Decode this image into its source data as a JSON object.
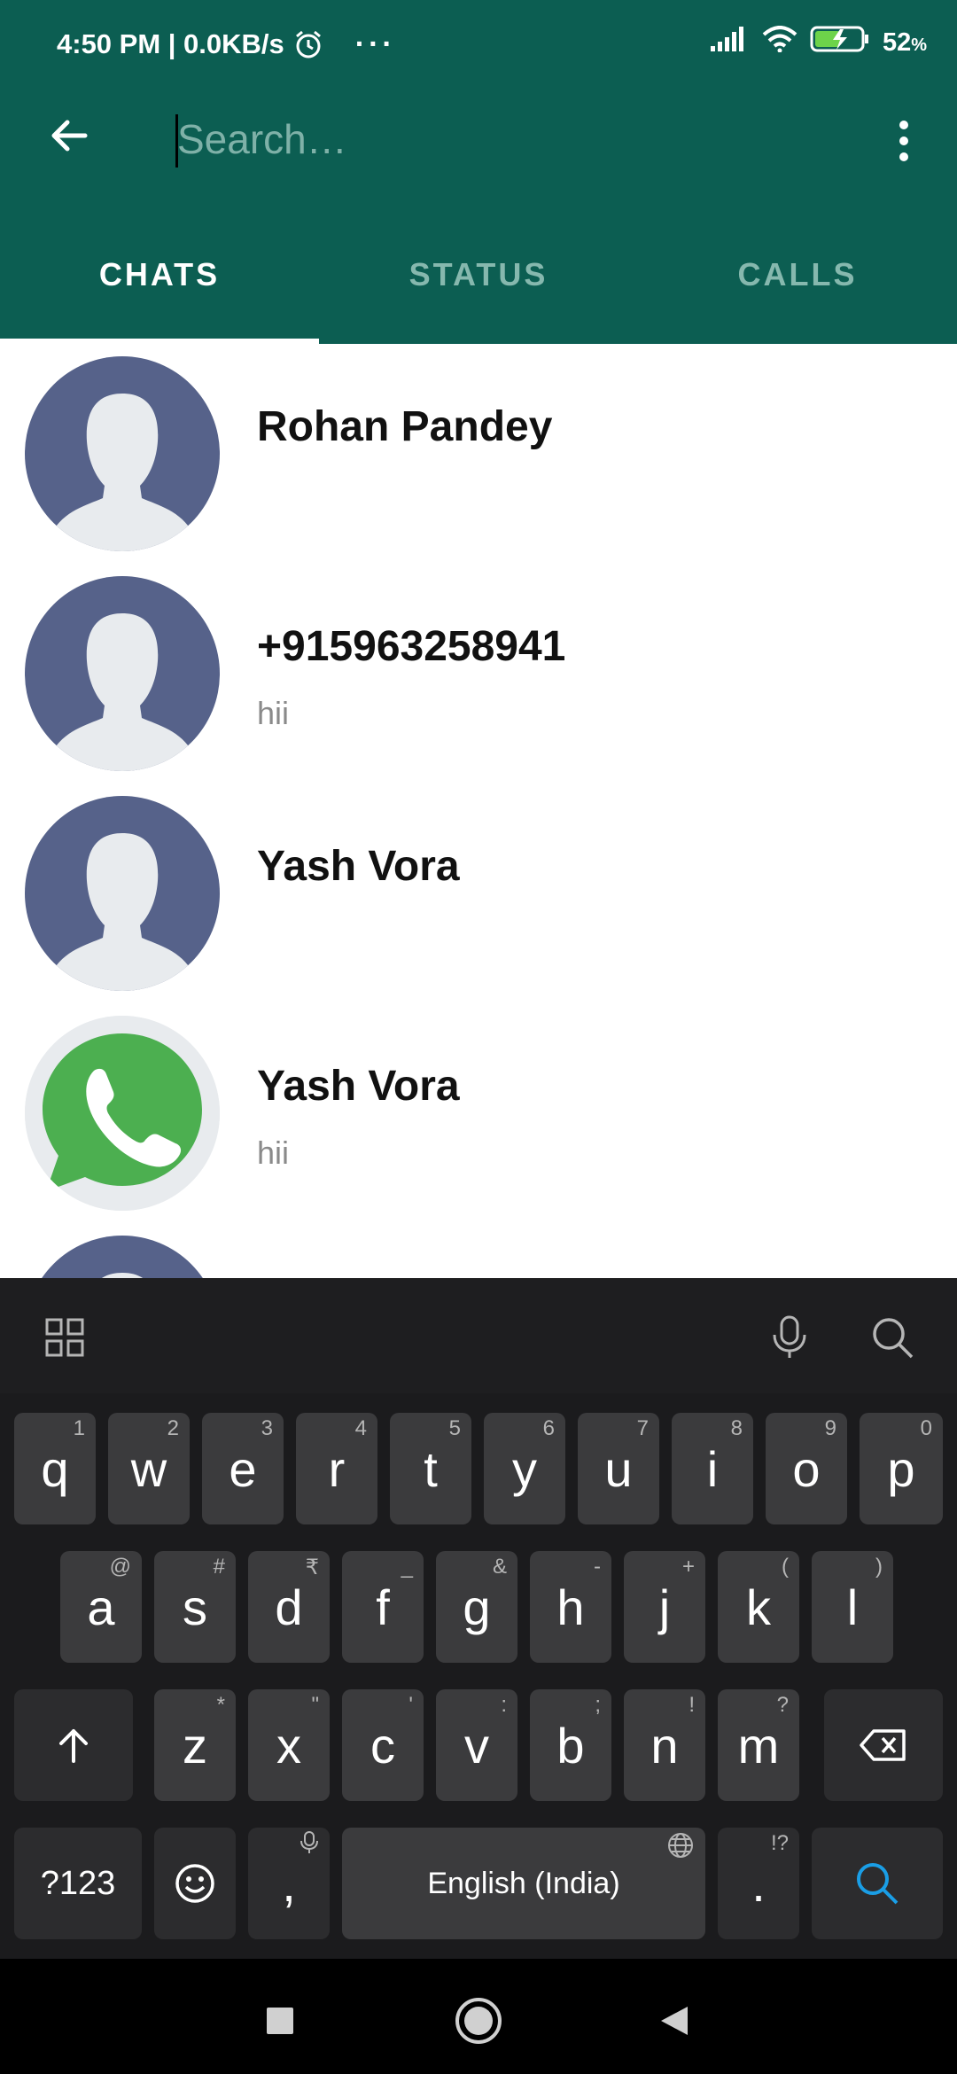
{
  "status_bar": {
    "time": "4:50 PM | 0.0KB/s",
    "more": "···",
    "battery_percent": "52",
    "battery_unit": "%",
    "icons": [
      "alarm-icon",
      "signal-icon",
      "wifi-icon",
      "battery-charging-icon"
    ]
  },
  "toolbar": {
    "search_placeholder": "Search…",
    "search_value": "",
    "back_icon": "arrow-left-icon",
    "menu_icon": "more-vert-icon"
  },
  "tabs": [
    {
      "label": "CHATS",
      "active": true
    },
    {
      "label": "STATUS",
      "active": false
    },
    {
      "label": "CALLS",
      "active": false
    }
  ],
  "chats": [
    {
      "name": "Rohan Pandey",
      "message": "",
      "avatar": "default-avatar"
    },
    {
      "name": "+915963258941",
      "message": "hii",
      "avatar": "default-avatar"
    },
    {
      "name": "Yash Vora",
      "message": "",
      "avatar": "default-avatar"
    },
    {
      "name": "Yash Vora",
      "message": "hii",
      "avatar": "whatsapp-avatar"
    }
  ],
  "keyboard": {
    "row1": [
      {
        "k": "q",
        "h": "1"
      },
      {
        "k": "w",
        "h": "2"
      },
      {
        "k": "e",
        "h": "3"
      },
      {
        "k": "r",
        "h": "4"
      },
      {
        "k": "t",
        "h": "5"
      },
      {
        "k": "y",
        "h": "6"
      },
      {
        "k": "u",
        "h": "7"
      },
      {
        "k": "i",
        "h": "8"
      },
      {
        "k": "o",
        "h": "9"
      },
      {
        "k": "p",
        "h": "0"
      }
    ],
    "row2": [
      {
        "k": "a",
        "h": "@"
      },
      {
        "k": "s",
        "h": "#"
      },
      {
        "k": "d",
        "h": "₹"
      },
      {
        "k": "f",
        "h": "_"
      },
      {
        "k": "g",
        "h": "&"
      },
      {
        "k": "h",
        "h": "-"
      },
      {
        "k": "j",
        "h": "+"
      },
      {
        "k": "k",
        "h": "("
      },
      {
        "k": "l",
        "h": ")"
      }
    ],
    "row3": [
      {
        "k": "z",
        "h": "*"
      },
      {
        "k": "x",
        "h": "\""
      },
      {
        "k": "c",
        "h": "'"
      },
      {
        "k": "v",
        "h": ":"
      },
      {
        "k": "b",
        "h": ";"
      },
      {
        "k": "n",
        "h": "!"
      },
      {
        "k": "m",
        "h": "?"
      }
    ],
    "symbols_label": "?123",
    "comma": ",",
    "space_label": "English (India)",
    "period": ".",
    "period_hint": "!?"
  },
  "colors": {
    "header_bg": "#0c5e52",
    "tab_inactive": "#86b8ae",
    "accent_search": "#1a9ee6",
    "whatsapp_green": "#4caf50"
  }
}
